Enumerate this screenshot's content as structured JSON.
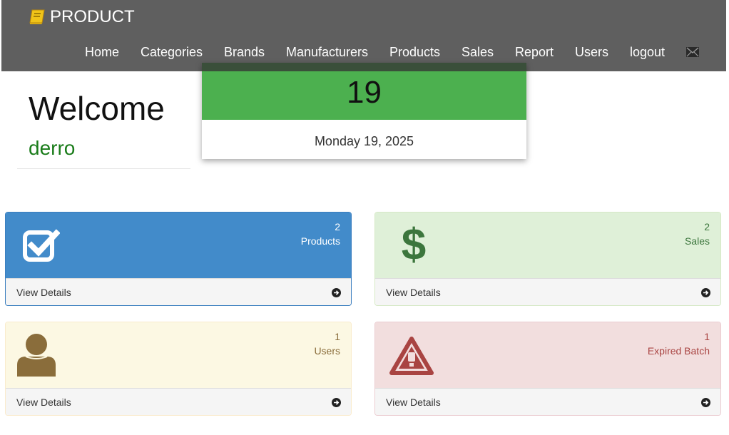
{
  "navbar": {
    "brand": "PRODUCT",
    "items": [
      {
        "label": "Home"
      },
      {
        "label": "Categories"
      },
      {
        "label": "Brands"
      },
      {
        "label": "Manufacturers"
      },
      {
        "label": "Products"
      },
      {
        "label": "Sales"
      },
      {
        "label": "Report"
      },
      {
        "label": "Users"
      },
      {
        "label": "logout"
      }
    ],
    "mail_icon": "envelope-icon"
  },
  "welcome": {
    "title": "Welcome",
    "user": "derro"
  },
  "date_card": {
    "day": "19",
    "full_date": "Monday 19, 2025"
  },
  "panels": {
    "products": {
      "count": "2",
      "label": "Products",
      "footer": "View Details",
      "icon": "checkbox-icon"
    },
    "sales": {
      "count": "2",
      "label": "Sales",
      "footer": "View Details",
      "icon": "dollar-icon"
    },
    "users": {
      "count": "1",
      "label": "Users",
      "footer": "View Details",
      "icon": "user-icon"
    },
    "expired": {
      "count": "1",
      "label": "Expired Batch",
      "footer": "View Details",
      "icon": "warning-icon"
    }
  },
  "colors": {
    "navbar": "#5f5f5f",
    "brand_icon": "#f0c419",
    "date_green": "#4cb04f",
    "welcome_user": "#1a7c1a",
    "panel_blue": "#428bca",
    "panel_green": "#dff0d8",
    "panel_yellow": "#fcf8e3",
    "panel_red": "#f2dede"
  }
}
